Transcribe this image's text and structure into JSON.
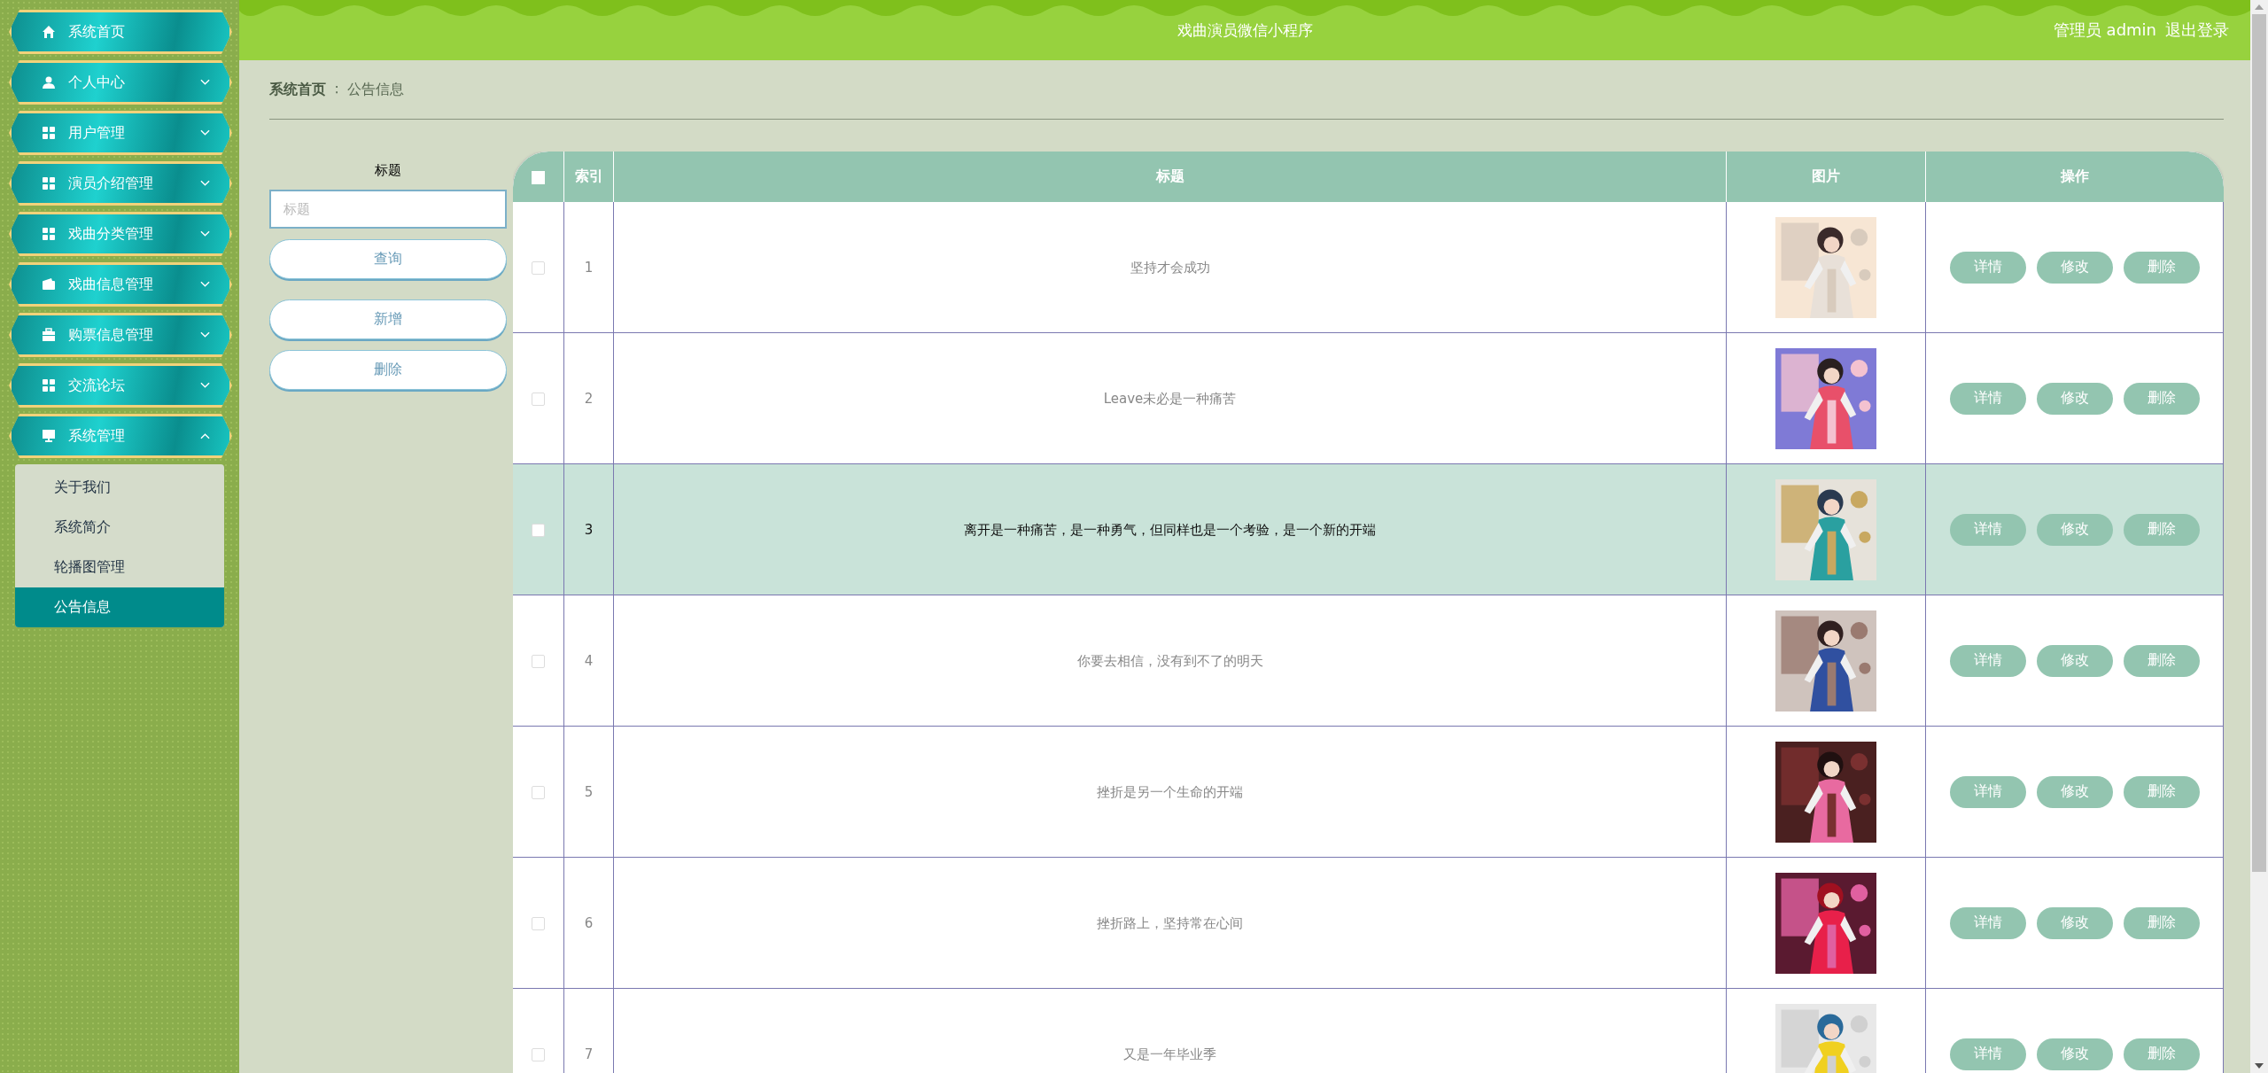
{
  "sidebar": {
    "items": [
      {
        "label": "系统首页",
        "kind": "home"
      },
      {
        "label": "个人中心",
        "kind": "user",
        "expanded": false
      },
      {
        "label": "用户管理",
        "kind": "grid",
        "expanded": false
      },
      {
        "label": "演员介绍管理",
        "kind": "grid",
        "expanded": false
      },
      {
        "label": "戏曲分类管理",
        "kind": "grid",
        "expanded": false
      },
      {
        "label": "戏曲信息管理",
        "kind": "wallet",
        "expanded": false
      },
      {
        "label": "购票信息管理",
        "kind": "case",
        "expanded": false
      },
      {
        "label": "交流论坛",
        "kind": "grid",
        "expanded": false
      },
      {
        "label": "系统管理",
        "kind": "monitor",
        "expanded": true,
        "children": [
          {
            "label": "关于我们",
            "selected": false
          },
          {
            "label": "系统简介",
            "selected": false
          },
          {
            "label": "轮播图管理",
            "selected": false
          },
          {
            "label": "公告信息",
            "selected": true
          }
        ]
      }
    ]
  },
  "header": {
    "title": "戏曲演员微信小程序",
    "user": "管理员 admin",
    "logout": "退出登录"
  },
  "breadcrumb": [
    "系统首页",
    "∶",
    "公告信息"
  ],
  "search": {
    "label": "标题",
    "placeholder": "标题",
    "buttons": [
      "查询",
      "新增",
      "删除"
    ]
  },
  "table": {
    "columns": [
      "索引",
      "标题",
      "图片",
      "操作"
    ],
    "all_checked": false,
    "rows": [
      {
        "index": "1",
        "title": "坚持才会成功",
        "checked": false,
        "selected": false,
        "actions": [
          "详情",
          "修改",
          "删除"
        ]
      },
      {
        "index": "2",
        "title": "Leave未必是一种痛苦",
        "checked": false,
        "selected": false,
        "actions": [
          "详情",
          "修改",
          "删除"
        ]
      },
      {
        "index": "3",
        "title": "离开是一种痛苦，是一种勇气，但同样也是一个考验，是一个新的开端",
        "checked": false,
        "selected": true,
        "actions": [
          "详情",
          "修改",
          "删除"
        ]
      },
      {
        "index": "4",
        "title": "你要去相信，没有到不了的明天",
        "checked": false,
        "selected": false,
        "actions": [
          "详情",
          "修改",
          "删除"
        ]
      },
      {
        "index": "5",
        "title": "挫折是另一个生命的开端",
        "checked": false,
        "selected": false,
        "actions": [
          "详情",
          "修改",
          "删除"
        ]
      },
      {
        "index": "6",
        "title": "挫折路上，坚持常在心间",
        "checked": false,
        "selected": false,
        "actions": [
          "详情",
          "修改",
          "删除"
        ]
      },
      {
        "index": "7",
        "title": "又是一年毕业季",
        "checked": false,
        "selected": false,
        "actions": [
          "详情",
          "修改",
          "删除"
        ]
      }
    ]
  }
}
